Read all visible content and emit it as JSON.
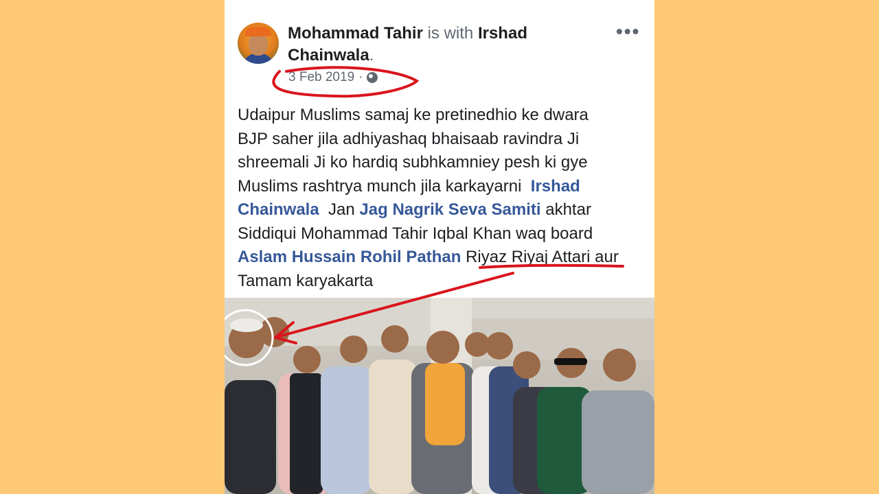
{
  "post": {
    "author": "Mohammad Tahir",
    "with_text": "is with",
    "tagged_person": "Irshad",
    "tagged_person_line2": "Chainwala",
    "period": ".",
    "date": "3 Feb 2019",
    "date_separator": "·",
    "privacy_icon": "globe-icon",
    "more_label": "•••",
    "text": {
      "l1": "Udaipur Muslims samaj ke pretinedhio ke dwara",
      "l2": "BJP saher jila adhiyashaq  bhaisaab ravindra Ji",
      "l3": "shreemali Ji ko hardiq subhkamniey pesh ki gye",
      "l4": "Muslims rashtrya munch jila karkayarni",
      "tag1a": "Irshad",
      "tag1b": "Chainwala",
      "l5a": "Jan",
      "tag2": "Jag Nagrik Seva Samiti",
      "l5b": "akhtar",
      "l6": "Siddiqui  Mohammad Tahir Iqbal Khan waq board",
      "tag3": "Aslam Hussain Rohil Pathan",
      "l7a": "Riyaz Riyaj Attari aur",
      "l8": "Tamam karyakarta"
    }
  },
  "colors": {
    "background": "#fec974",
    "card": "#ffffff",
    "link": "#365899",
    "annotation": "#d9141c"
  }
}
